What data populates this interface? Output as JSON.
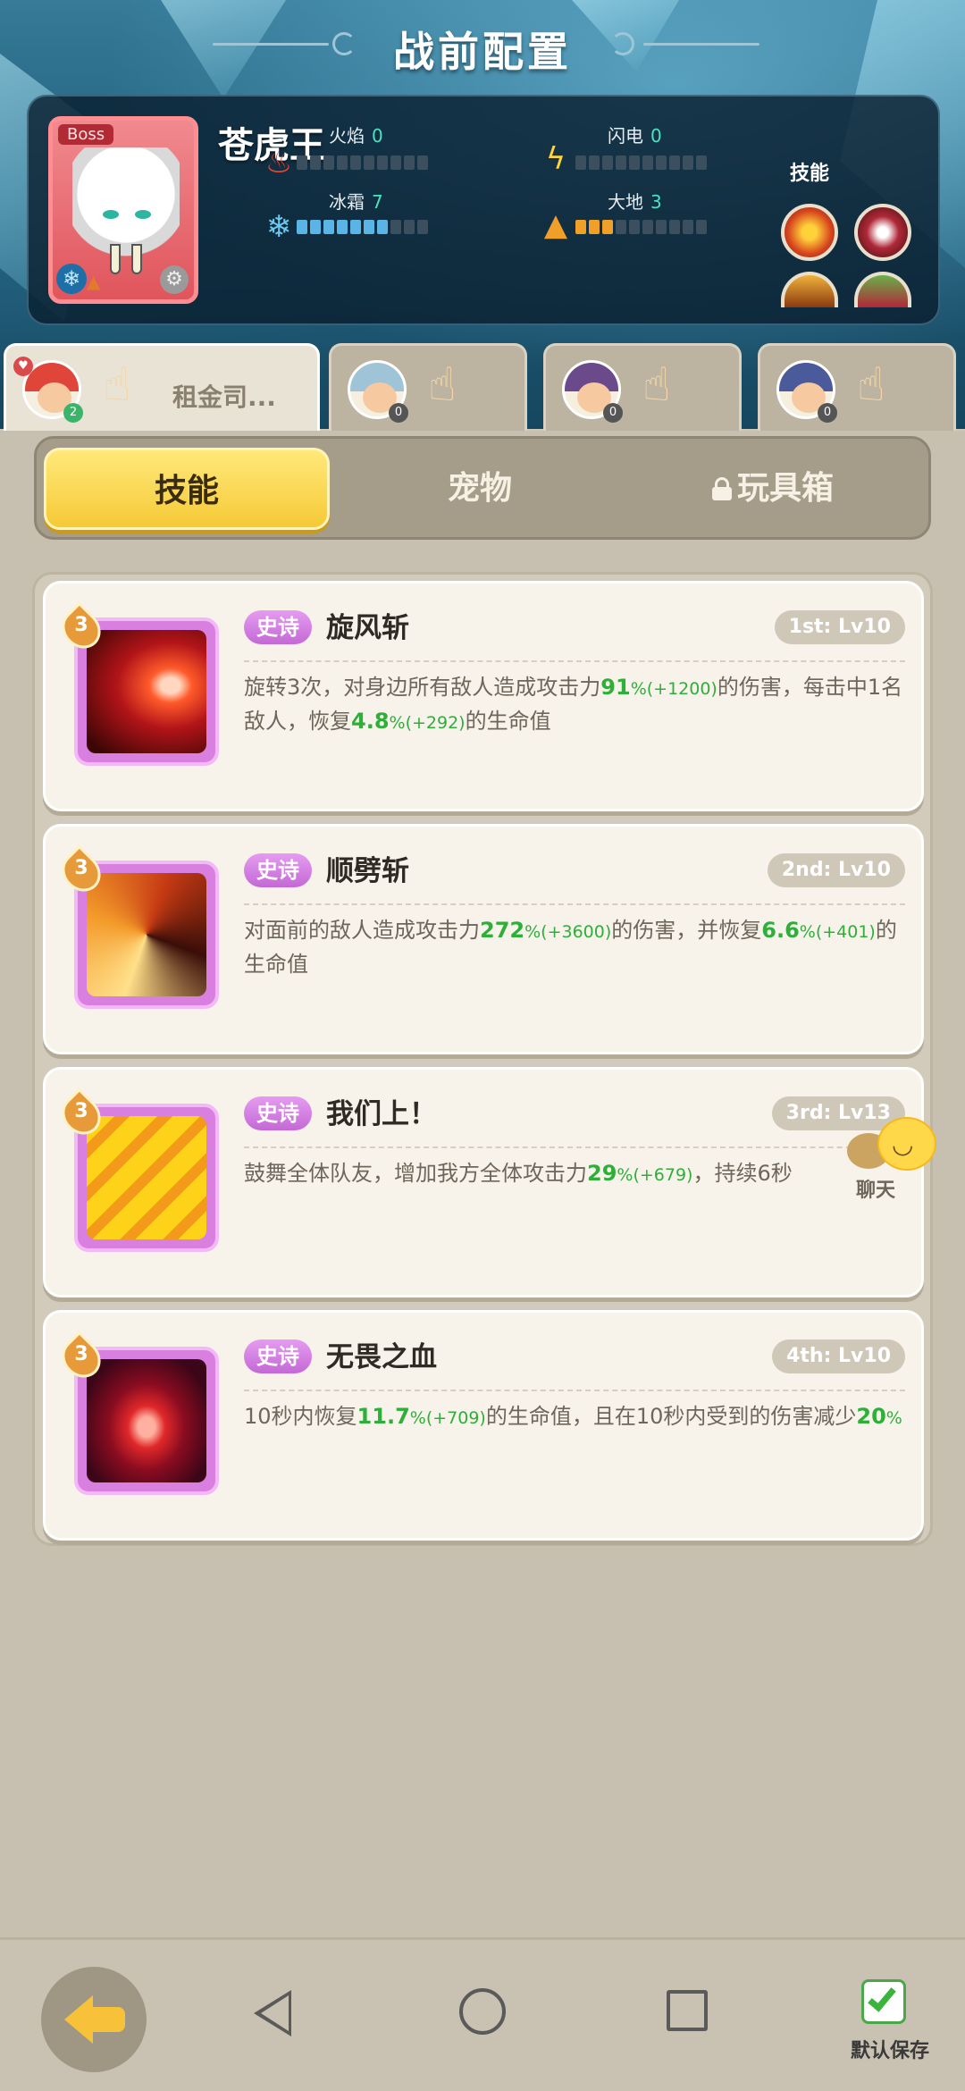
{
  "header": {
    "title": "战前配置"
  },
  "boss": {
    "tag": "Boss",
    "name": "苍虎王",
    "stats": {
      "fire": {
        "label": "火焰",
        "value": "0",
        "level": 0,
        "max": 10
      },
      "lightning": {
        "label": "闪电",
        "value": "0",
        "level": 0,
        "max": 10
      },
      "ice": {
        "label": "冰霜",
        "value": "7",
        "level": 7,
        "max": 10
      },
      "earth": {
        "label": "大地",
        "value": "3",
        "level": 3,
        "max": 10
      }
    },
    "skills_label": "技能",
    "skill_icons": [
      "fire-slash-icon",
      "fang-bite-icon",
      "claw-icon",
      "leaf-claw-icon"
    ]
  },
  "heroes": [
    {
      "name": "租金司...",
      "badge": "2",
      "active": true
    },
    {
      "name": "",
      "badge": "0",
      "active": false
    },
    {
      "name": "",
      "badge": "0",
      "active": false
    },
    {
      "name": "",
      "badge": "0",
      "active": false
    }
  ],
  "tabs": {
    "skills": "技能",
    "pets": "宠物",
    "toybox": "玩具箱",
    "active": "skills"
  },
  "skills": [
    {
      "level": "3",
      "rarity": "史诗",
      "name": "旋风斩",
      "slot": "1st: Lv10",
      "desc": [
        {
          "t": "旋转3次，对身边所有敌人造成攻击力"
        },
        {
          "t": "91",
          "c": "g"
        },
        {
          "t": "%(+1200)",
          "c": "gs"
        },
        {
          "t": "的伤害，每击中1名敌人，恢复"
        },
        {
          "t": "4.8",
          "c": "g"
        },
        {
          "t": "%(+292)",
          "c": "gs"
        },
        {
          "t": "的生命值"
        }
      ]
    },
    {
      "level": "3",
      "rarity": "史诗",
      "name": "顺劈斩",
      "slot": "2nd: Lv10",
      "desc": [
        {
          "t": "对面前的敌人造成攻击力"
        },
        {
          "t": "272",
          "c": "g"
        },
        {
          "t": "%(+3600)",
          "c": "gs"
        },
        {
          "t": "的伤害，并恢复"
        },
        {
          "t": "6.6",
          "c": "g"
        },
        {
          "t": "%(+401)",
          "c": "gs"
        },
        {
          "t": "的生命值"
        }
      ]
    },
    {
      "level": "3",
      "rarity": "史诗",
      "name": "我们上！",
      "slot": "3rd: Lv13",
      "desc": [
        {
          "t": "鼓舞全体队友，增加我方全体攻击力"
        },
        {
          "t": "29",
          "c": "g"
        },
        {
          "t": "%(+679)",
          "c": "gs"
        },
        {
          "t": "，持续6秒"
        }
      ]
    },
    {
      "level": "3",
      "rarity": "史诗",
      "name": "无畏之血",
      "slot": "4th: Lv10",
      "desc": [
        {
          "t": "10秒内恢复"
        },
        {
          "t": "11.7",
          "c": "g"
        },
        {
          "t": "%(+709)",
          "c": "gs"
        },
        {
          "t": "的生命值，且在10秒内受到的伤害减少"
        },
        {
          "t": "20",
          "c": "g"
        },
        {
          "t": "%",
          "c": "gs"
        }
      ]
    }
  ],
  "chat": {
    "label": "聊天"
  },
  "footer": {
    "save_label": "默认保存",
    "save_checked": true
  },
  "colors": {
    "accent_yellow": "#f6c936",
    "rarity_epic": "#c468d6",
    "value_green": "#2fae3a"
  }
}
